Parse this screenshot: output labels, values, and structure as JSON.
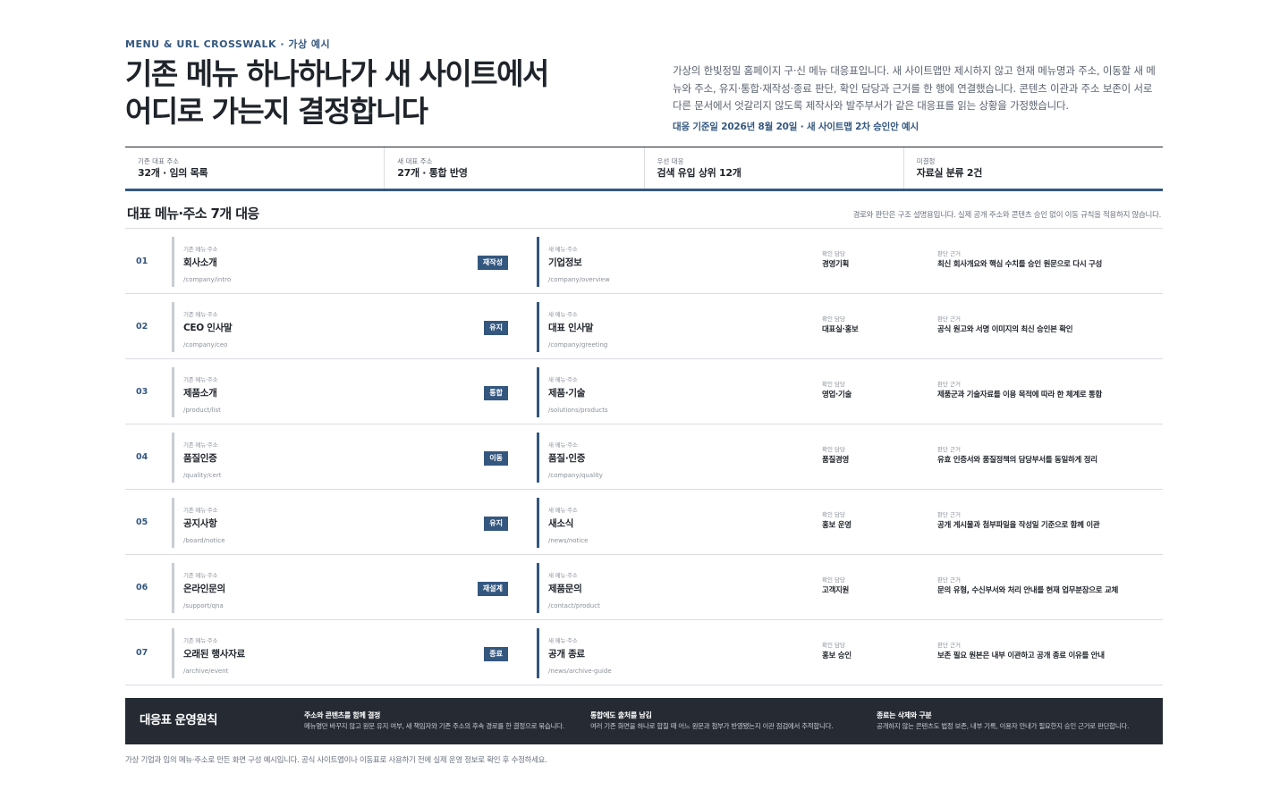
{
  "header": {
    "eyebrow": "MENU & URL CROSSWALK · 가상 예시",
    "title_line1": "기존 메뉴 하나하나가 새 사이트에서",
    "title_line2": "어디로 가는지 결정합니다",
    "lead": "가상의 한빛정밀 홈페이지 구·신 메뉴 대응표입니다. 새 사이트맵만 제시하지 않고 현재 메뉴명과 주소, 이동할 새 메뉴와 주소, 유지·통합·재작성·종료 판단, 확인 담당과 근거를 한 행에 연결했습니다. 콘텐츠 이관과 주소 보존이 서로 다른 문서에서 엇갈리지 않도록 제작사와 발주부서가 같은 대응표를 읽는 상황을 가정했습니다.",
    "basis": "대응 기준일 2026년 8월 20일 · 새 사이트맵 2차 승인안 예시"
  },
  "stats": [
    {
      "label": "기존 대표 주소",
      "value": "32개 · 임의 목록"
    },
    {
      "label": "새 대표 주소",
      "value": "27개 · 통합 반영"
    },
    {
      "label": "우선 대응",
      "value": "검색 유입 상위 12개"
    },
    {
      "label": "미결정",
      "value": "자료실 분류 2건"
    }
  ],
  "section": {
    "title": "대표 메뉴·주소 7개 대응",
    "note": "경로와 판단은 구조 설명용입니다. 실제 공개 주소와 콘텐츠 승인 없이 이동 규칙을 적용하지 않습니다."
  },
  "labels": {
    "old": "기존 메뉴·주소",
    "new": "새 메뉴·주소",
    "owner": "확인 담당",
    "basis": "판단 근거"
  },
  "rows": [
    {
      "num": "01",
      "old_name": "회사소개",
      "old_url": "/company/intro",
      "action": "재작성",
      "new_name": "기업정보",
      "new_url": "/company/overview",
      "owner": "경영기획",
      "basis": "최신 회사개요와 핵심 수치를 승인 원문으로 다시 구성"
    },
    {
      "num": "02",
      "old_name": "CEO 인사말",
      "old_url": "/company/ceo",
      "action": "유지",
      "new_name": "대표 인사말",
      "new_url": "/company/greeting",
      "owner": "대표실·홍보",
      "basis": "공식 원고와 서명 이미지의 최신 승인본 확인"
    },
    {
      "num": "03",
      "old_name": "제품소개",
      "old_url": "/product/list",
      "action": "통합",
      "new_name": "제품·기술",
      "new_url": "/solutions/products",
      "owner": "영업·기술",
      "basis": "제품군과 기술자료를 이용 목적에 따라 한 체계로 통합"
    },
    {
      "num": "04",
      "old_name": "품질인증",
      "old_url": "/quality/cert",
      "action": "이동",
      "new_name": "품질·인증",
      "new_url": "/company/quality",
      "owner": "품질경영",
      "basis": "유효 인증서와 품질정책의 담당부서를 동일하게 정리"
    },
    {
      "num": "05",
      "old_name": "공지사항",
      "old_url": "/board/notice",
      "action": "유지",
      "new_name": "새소식",
      "new_url": "/news/notice",
      "owner": "홍보 운영",
      "basis": "공개 게시물과 첨부파일을 작성일 기준으로 함께 이관"
    },
    {
      "num": "06",
      "old_name": "온라인문의",
      "old_url": "/support/qna",
      "action": "재설계",
      "new_name": "제품문의",
      "new_url": "/contact/product",
      "owner": "고객지원",
      "basis": "문의 유형, 수신부서와 처리 안내를 현재 업무분장으로 교체"
    },
    {
      "num": "07",
      "old_name": "오래된 행사자료",
      "old_url": "/archive/event",
      "action": "종료",
      "new_name": "공개 종료",
      "new_url": "/news/archive-guide",
      "owner": "홍보 승인",
      "basis": "보존 필요 원본은 내부 이관하고 공개 종료 이유를 안내"
    }
  ],
  "principles": {
    "title": "대응표 운영원칙",
    "items": [
      {
        "title": "주소와 콘텐츠를 함께 결정",
        "text": "메뉴명만 바꾸지 않고 원문 유지 여부, 새 책임자와 기존 주소의 후속 경로를 한 결정으로 묶습니다."
      },
      {
        "title": "통합에도 출처를 남김",
        "text": "여러 기존 화면을 하나로 합칠 때 어느 원문과 첨부가 반영됐는지 이관 점검에서 추적합니다."
      },
      {
        "title": "종료는 삭제와 구분",
        "text": "공개하지 않는 콘텐츠도 법정 보존, 내부 기록, 이용자 안내가 필요한지 승인 근거로 판단합니다."
      }
    ]
  },
  "footer": "가상 기업과 임의 메뉴·주소로 만든 화면 구성 예시입니다. 공식 사이트맵이나 이동표로 사용하기 전에 실제 운영 정보로 확인 후 수정하세요."
}
